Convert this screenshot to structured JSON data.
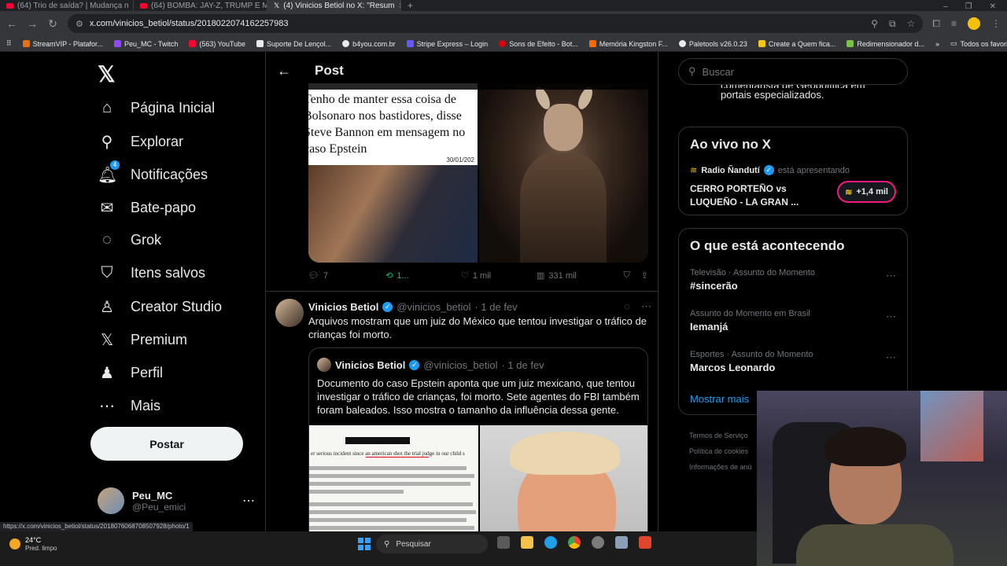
{
  "browser": {
    "tabs": [
      {
        "label": "(64) Trio de saída? | Mudança n",
        "icon": "youtube-icon"
      },
      {
        "label": "(64) BOMBA: JAY-Z, TRUMP E M",
        "icon": "youtube-icon"
      },
      {
        "label": "(4) Vinicios Betiol no X: \"Resum",
        "icon": "x-icon"
      }
    ],
    "url": "x.com/vinicios_betiol/status/2018022074162257983",
    "bookmarks": [
      {
        "label": "StreamVIP - Platafor...",
        "color": "#e8710a"
      },
      {
        "label": "Peu_MC - Twitch",
        "color": "#9146ff"
      },
      {
        "label": "(563) YouTube",
        "color": "#ff0033"
      },
      {
        "label": "Suporte De Lençol...",
        "color": "#e8eaed"
      },
      {
        "label": "b4you.com.br",
        "color": "#e8eaed"
      },
      {
        "label": "Stripe Express – Login",
        "color": "#635bff"
      },
      {
        "label": "Sons de Efeito - Bot...",
        "color": "#d01"
      },
      {
        "label": "Memória Kingston F...",
        "color": "#ff6a00"
      },
      {
        "label": "Paletools v26.0.23",
        "color": "#e8eaed"
      },
      {
        "label": "Create a Quem fica...",
        "color": "#f5c518"
      },
      {
        "label": "Redimensionador d...",
        "color": "#7cc242"
      }
    ],
    "all_bookmarks": "Todos os favoritos"
  },
  "nav": {
    "items": [
      {
        "label": "Página Inicial",
        "icon": "home-icon",
        "glyph": "⌂"
      },
      {
        "label": "Explorar",
        "icon": "search-icon",
        "glyph": "⚲"
      },
      {
        "label": "Notificações",
        "icon": "bell-icon",
        "glyph": "🔔︎"
      },
      {
        "label": "Bate-papo",
        "icon": "mail-icon",
        "glyph": "✉"
      },
      {
        "label": "Grok",
        "icon": "grok-icon",
        "glyph": "◌"
      },
      {
        "label": "Itens salvos",
        "icon": "bookmark-icon",
        "glyph": "⛉"
      },
      {
        "label": "Creator Studio",
        "icon": "creator-icon",
        "glyph": "♙"
      },
      {
        "label": "Premium",
        "icon": "x-icon",
        "glyph": "𝕏"
      },
      {
        "label": "Perfil",
        "icon": "person-icon",
        "glyph": "♟"
      },
      {
        "label": "Mais",
        "icon": "more-icon",
        "glyph": "⋯"
      }
    ],
    "notif_badge": "4",
    "post_button": "Postar",
    "account": {
      "name": "Peu_MC",
      "handle": "@Peu_emici"
    }
  },
  "center": {
    "header_title": "Post",
    "top_media": {
      "headline": "Tenho de manter essa coisa de Bolsonaro nos bastidores, disse Steve Bannon em mensagem no caso Epstein",
      "date": "30/01/202"
    },
    "actions": {
      "replies": "7",
      "reposts": "1...",
      "likes": "1 mil",
      "views": "331 mil"
    },
    "post2": {
      "name": "Vinicios Betiol",
      "handle": "@vinicios_betiol",
      "date": "· 1 de fev",
      "text": "Arquivos mostram que um juiz do México que tentou investigar o tráfico de crianças foi morto."
    },
    "quote": {
      "name": "Vinicios Betiol",
      "handle": "@vinicios_betiol",
      "date": "· 1 de fev",
      "text": "Documento do caso Epstein aponta que um juiz mexicano, que tentou investigar o tráfico de crianças, foi morto. Sete agentes do FBI também foram baleados. Isso mostra o tamanho da influência dessa gente.",
      "doc_snippet": "er serious incident since an american shot the trial judge in our child s"
    }
  },
  "right": {
    "search_placeholder": "Buscar",
    "fragment_line1": "comentarista de Geopolítica em",
    "fragment_line2": "portais especializados.",
    "live": {
      "title": "Ao vivo no X",
      "host": "Radio Ñandutí",
      "status": "está apresentando",
      "event": "CERRO PORTEÑO vs LUQUEÑO - LA GRAN ...",
      "listeners": "+1,4 mil"
    },
    "trends_title": "O que está acontecendo",
    "trends": [
      {
        "meta": "Televisão · Assunto do Momento",
        "name": "#sincerão"
      },
      {
        "meta": "Assunto do Momento em Brasil",
        "name": "Iemanjá"
      },
      {
        "meta": "Esportes · Assunto do Momento",
        "name": "Marcos Leonardo"
      }
    ],
    "show_more": "Mostrar mais",
    "footer": [
      "Termos de Serviço",
      "Política de cookies",
      "Informações de anú"
    ]
  },
  "status_url": "https://x.com/vinicios_betiol/status/2018076068708507928/photo/1",
  "taskbar": {
    "temp": "24°C",
    "condition": "Pred. limpo",
    "search": "Pesquisar"
  }
}
